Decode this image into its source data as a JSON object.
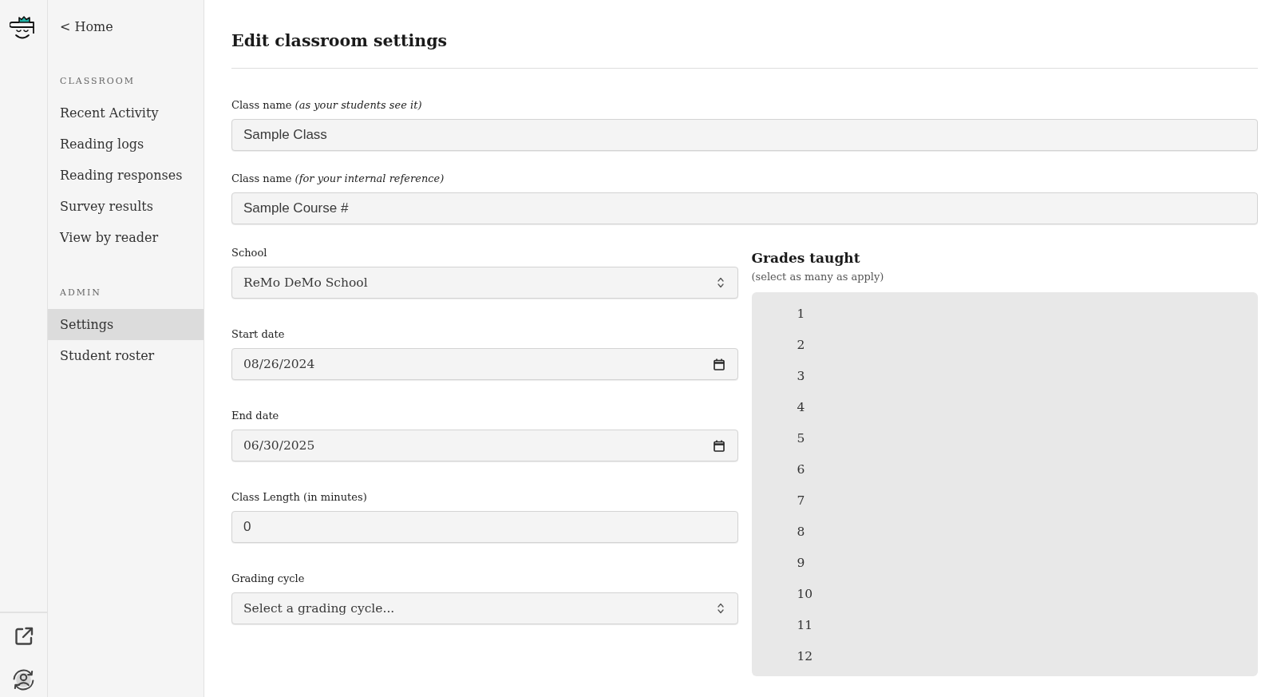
{
  "sidebar": {
    "home_link": "< Home",
    "sections": [
      {
        "heading": "CLASSROOM",
        "items": [
          {
            "label": "Recent Activity",
            "selected": false
          },
          {
            "label": "Reading logs",
            "selected": false
          },
          {
            "label": "Reading responses",
            "selected": false
          },
          {
            "label": "Survey results",
            "selected": false
          },
          {
            "label": "View by reader",
            "selected": false
          }
        ]
      },
      {
        "heading": "ADMIN",
        "items": [
          {
            "label": "Settings",
            "selected": true
          },
          {
            "label": "Student roster",
            "selected": false
          }
        ]
      }
    ]
  },
  "page": {
    "title": "Edit classroom settings"
  },
  "form": {
    "wide_fields": [
      {
        "kind": "text",
        "label": "Class name *(as your students see it)*",
        "value": "Sample Class"
      },
      {
        "kind": "text",
        "label": "Class name *(for your internal reference)*",
        "value": "Sample Course #"
      }
    ],
    "left_fields": [
      {
        "kind": "select",
        "label": "School",
        "value": "ReMo DeMo School"
      },
      {
        "kind": "date",
        "label": "Start date",
        "value": "08/26/2024"
      },
      {
        "kind": "date",
        "label": "End date",
        "value": "06/30/2025"
      },
      {
        "kind": "number",
        "label": "Class Length (in minutes)",
        "value": "0"
      },
      {
        "kind": "select",
        "label": "Grading cycle",
        "value": "Select a grading cycle..."
      }
    ],
    "grades": {
      "title": "Grades taught",
      "hint": "(select as many as apply)",
      "options": [
        {
          "label": "1",
          "selected": false
        },
        {
          "label": "2",
          "selected": false
        },
        {
          "label": "3",
          "selected": false
        },
        {
          "label": "4",
          "selected": false
        },
        {
          "label": "5",
          "selected": false
        },
        {
          "label": "6",
          "selected": false
        },
        {
          "label": "7",
          "selected": false
        },
        {
          "label": "8",
          "selected": false
        },
        {
          "label": "9",
          "selected": false
        },
        {
          "label": "10",
          "selected": false
        },
        {
          "label": "11",
          "selected": false
        },
        {
          "label": "12",
          "selected": false
        }
      ]
    }
  }
}
